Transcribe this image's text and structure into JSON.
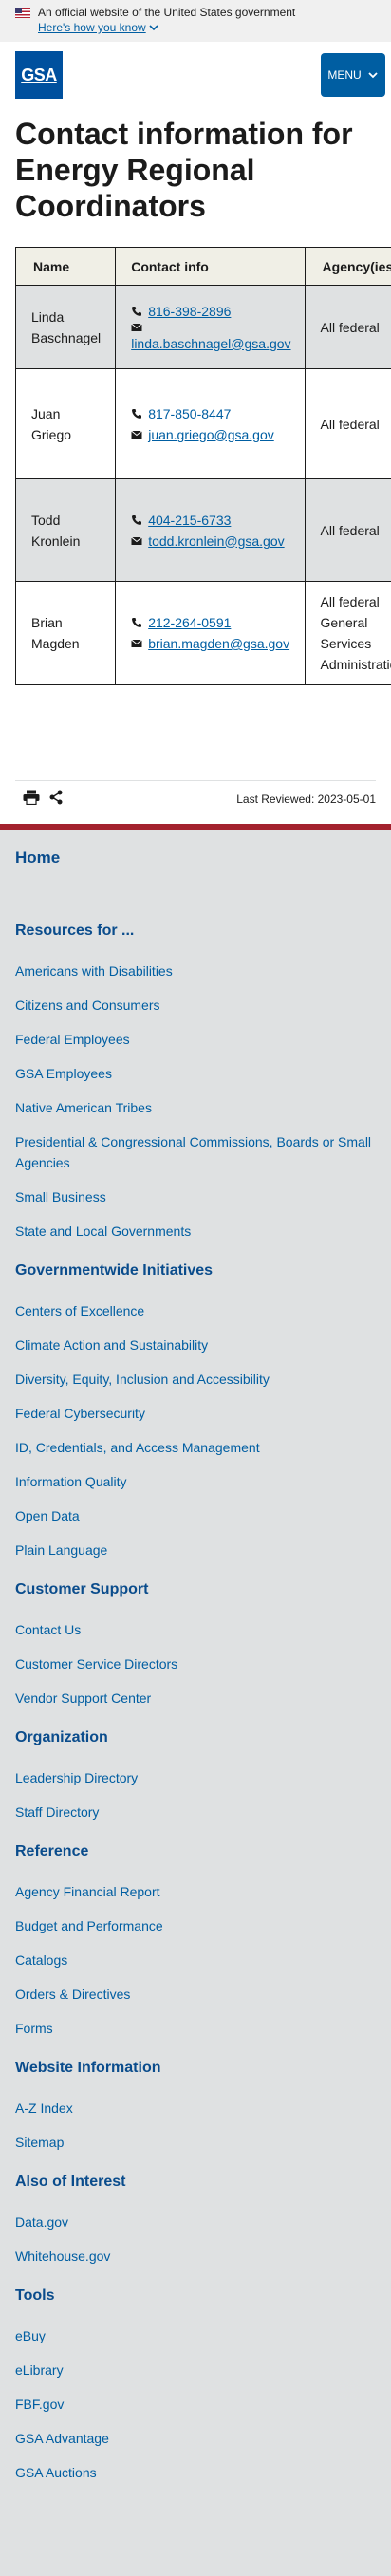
{
  "banner": {
    "text": "An official website of the United States government",
    "link": "Here's how you know"
  },
  "header": {
    "logo": "GSA",
    "menu_label": "MENU"
  },
  "page": {
    "title": "Contact information for Energy Regional Coordinators"
  },
  "table": {
    "headers": [
      "Name",
      "Contact info",
      "Agency(ies)"
    ],
    "rows": [
      {
        "name": "Linda Baschnagel",
        "phone": "816-398-2896",
        "email": "linda.baschnagel@gsa.gov",
        "agency": "All federal"
      },
      {
        "name": "Juan Griego",
        "phone": "817-850-8447",
        "email": "juan.griego@gsa.gov",
        "agency": "All federal"
      },
      {
        "name": "Todd Kronlein",
        "phone": "404-215-6733",
        "email": "todd.kronlein@gsa.gov",
        "agency": "All federal"
      },
      {
        "name": "Brian Magden",
        "phone": "212-264-0591",
        "email": "brian.magden@gsa.gov",
        "agency": "All federal General Services Administration"
      }
    ]
  },
  "page_tools": {
    "last_reviewed": "Last Reviewed: 2023-05-01"
  },
  "footer": {
    "home": "Home",
    "sections": [
      {
        "title": "Resources for ...",
        "links": [
          "Americans with Disabilities",
          "Citizens and Consumers",
          "Federal Employees",
          "GSA Employees",
          "Native American Tribes",
          "Presidential & Congressional Commissions, Boards or Small Agencies",
          "Small Business",
          "State and Local Governments"
        ]
      },
      {
        "title": "Governmentwide Initiatives",
        "links": [
          "Centers of Excellence",
          "Climate Action and Sustainability",
          "Diversity, Equity, Inclusion and Accessibility",
          "Federal Cybersecurity",
          "ID, Credentials, and Access Management",
          "Information Quality",
          "Open Data",
          "Plain Language"
        ]
      },
      {
        "title": "Customer Support",
        "links": [
          "Contact Us",
          "Customer Service Directors",
          "Vendor Support Center"
        ]
      },
      {
        "title": "Organization",
        "links": [
          "Leadership Directory",
          "Staff Directory"
        ]
      },
      {
        "title": "Reference",
        "links": [
          "Agency Financial Report",
          "Budget and Performance",
          "Catalogs",
          "Orders & Directives",
          "Forms"
        ]
      },
      {
        "title": "Website Information",
        "links": [
          "A-Z Index",
          "Sitemap"
        ]
      },
      {
        "title": "Also of Interest",
        "links": [
          "Data.gov",
          "Whitehouse.gov"
        ]
      },
      {
        "title": "Tools",
        "links": [
          "eBuy",
          "eLibrary",
          "FBF.gov",
          "GSA Advantage",
          "GSA Auctions"
        ]
      }
    ]
  },
  "colors": {
    "primary": "#005ea2",
    "footer_bg": "#dfe1e2",
    "footer_rule": "#a3222e",
    "heading_blue": "#0a4c8c"
  },
  "icons": [
    "us-flag-icon",
    "chevron-down-icon",
    "phone-icon",
    "envelope-icon",
    "print-icon",
    "share-icon"
  ]
}
